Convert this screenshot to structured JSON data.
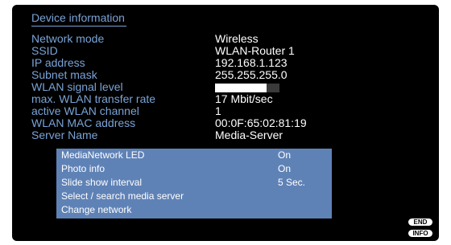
{
  "header": {
    "title": "Device information"
  },
  "info": {
    "network_mode": {
      "label": "Network mode",
      "value": "Wireless"
    },
    "ssid": {
      "label": "SSID",
      "value": "WLAN-Router 1"
    },
    "ip_address": {
      "label": "IP address",
      "value": "192.168.1.123"
    },
    "subnet_mask": {
      "label": "Subnet mask",
      "value": "255.255.255.0"
    },
    "signal_level": {
      "label": "WLAN signal level",
      "fraction": 0.8
    },
    "transfer_rate": {
      "label": "max. WLAN transfer rate",
      "value": "17 Mbit/sec"
    },
    "channel": {
      "label": "active WLAN channel",
      "value": "1"
    },
    "mac_address": {
      "label": "WLAN MAC address",
      "value": "00:0F:65:02:81:19"
    },
    "server_name": {
      "label": "Server Name",
      "value": "Media-Server"
    }
  },
  "menu": {
    "items": [
      {
        "label": "MediaNetwork LED",
        "value": "On"
      },
      {
        "label": "Photo info",
        "value": "On"
      },
      {
        "label": "Slide show interval",
        "value": "5 Sec."
      },
      {
        "label": "Select / search media server",
        "value": ""
      },
      {
        "label": "Change network",
        "value": ""
      }
    ]
  },
  "buttons": {
    "end_label": "END",
    "info_label": "INFO"
  },
  "colors": {
    "background": "#000000",
    "label_text": "#7aa3d6",
    "value_text": "#ffffff",
    "menu_background": "#5f82b6"
  }
}
